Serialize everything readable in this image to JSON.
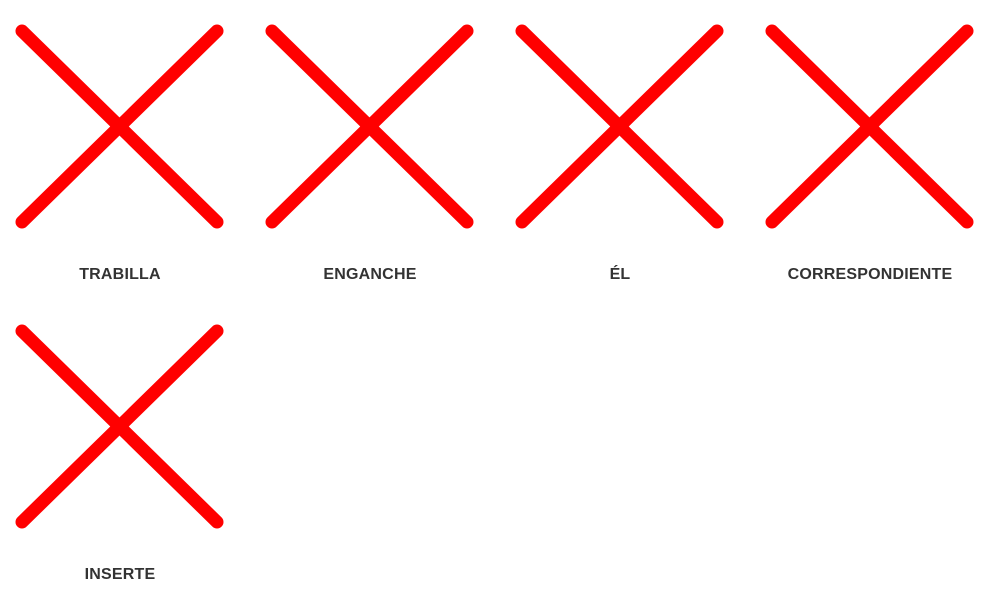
{
  "colors": {
    "icon": "#ff0000",
    "label": "#333333",
    "background": "#ffffff"
  },
  "items": [
    {
      "icon": "close-icon",
      "label": "TRABILLA"
    },
    {
      "icon": "close-icon",
      "label": "ENGANCHE"
    },
    {
      "icon": "close-icon",
      "label": "ÉL"
    },
    {
      "icon": "close-icon",
      "label": "CORRESPONDIENTE"
    },
    {
      "icon": "close-icon",
      "label": "INSERTE"
    }
  ]
}
